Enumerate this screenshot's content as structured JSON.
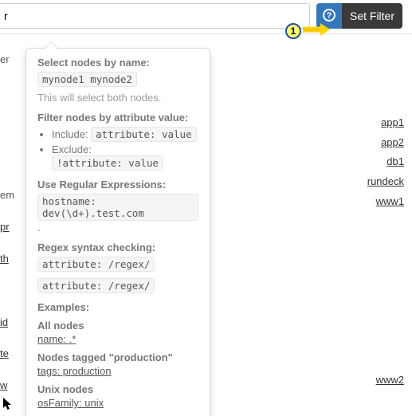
{
  "filter": {
    "input_value": "r",
    "set_label": "Set Filter"
  },
  "annotation": {
    "label": "1"
  },
  "popover": {
    "section1_title": "Select nodes by name:",
    "section1_code": "mynode1 mynode2",
    "section1_note": "This will select both nodes.",
    "section2_title": "Filter nodes by attribute value:",
    "include_prefix": "Include: ",
    "include_code": "attribute: value",
    "exclude_prefix": "Exclude: ",
    "exclude_code": "!attribute: value",
    "section3_title": "Use Regular Expressions:",
    "section3_code": "hostname: dev(\\d+).test.com",
    "section3_trailing": " .",
    "section4_title": "Regex syntax checking:",
    "section4_code1": "attribute: /regex/",
    "section4_code2": "attribute: /regex/",
    "examples_title": "Examples:",
    "ex1_label": "All nodes",
    "ex1_link": "name: .*",
    "ex2_label": "Nodes tagged \"production\"",
    "ex2_link": "tags: production",
    "ex3_label": "Unix nodes",
    "ex3_link": "osFamily: unix"
  },
  "right_links": {
    "l1": "app1",
    "l2": "app2",
    "l3": "db1",
    "l4": "rundeck",
    "l5": "www1",
    "l6": "www2"
  },
  "left_fragments": {
    "f1": "er",
    "f2": "em",
    "f3": "pr",
    "f4": "th",
    "f5": "id",
    "f6": "te",
    "f7": "w"
  }
}
